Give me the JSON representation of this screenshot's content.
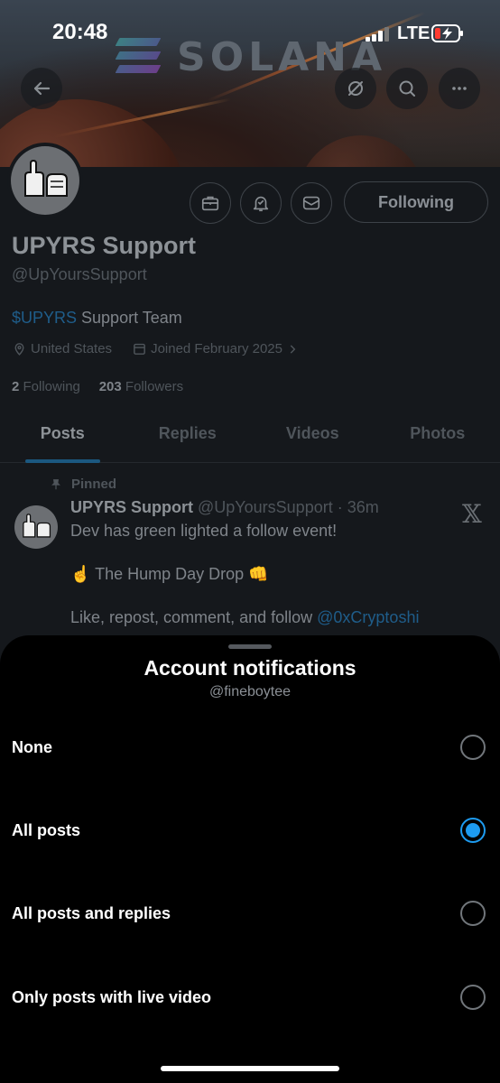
{
  "status_bar": {
    "time": "20:48",
    "network": "LTE"
  },
  "banner": {
    "brand": "SOLANA"
  },
  "nav": {
    "back_icon": "arrow-left-icon",
    "grok_icon": "slashed-circle-icon",
    "search_icon": "search-icon",
    "more_icon": "more-horizontal-icon"
  },
  "profile": {
    "name": "UPYRS Support",
    "handle": "@UpYoursSupport",
    "bio_cashtag": "$UPYRS",
    "bio_rest": " Support Team",
    "location": "United States",
    "joined": "Joined February 2025",
    "following_count": "2",
    "following_label": " Following",
    "followers_count": "203",
    "followers_label": " Followers",
    "follow_button": "Following"
  },
  "tabs": [
    {
      "label": "Posts",
      "active": true
    },
    {
      "label": "Replies",
      "active": false
    },
    {
      "label": "Videos",
      "active": false
    },
    {
      "label": "Photos",
      "active": false
    }
  ],
  "post": {
    "pinned_label": "Pinned",
    "author_name": "UPYRS Support",
    "author_meta": " @UpYoursSupport · 36m",
    "line1": "Dev has green lighted a follow event!",
    "line2": "☝️ The Hump Day Drop 👊",
    "line3_text": "Like, repost, comment, and follow ",
    "line3_mention": "@0xCryptoshi"
  },
  "sheet": {
    "title": "Account notifications",
    "subtitle": "@fineboytee",
    "options": [
      {
        "label": "None",
        "selected": false
      },
      {
        "label": "All posts",
        "selected": true
      },
      {
        "label": "All posts and replies",
        "selected": false
      },
      {
        "label": "Only posts with live video",
        "selected": false
      }
    ]
  },
  "colors": {
    "accent": "#1d9bf0",
    "sheet_bg": "#000000",
    "dim_bg": "#15181c"
  }
}
